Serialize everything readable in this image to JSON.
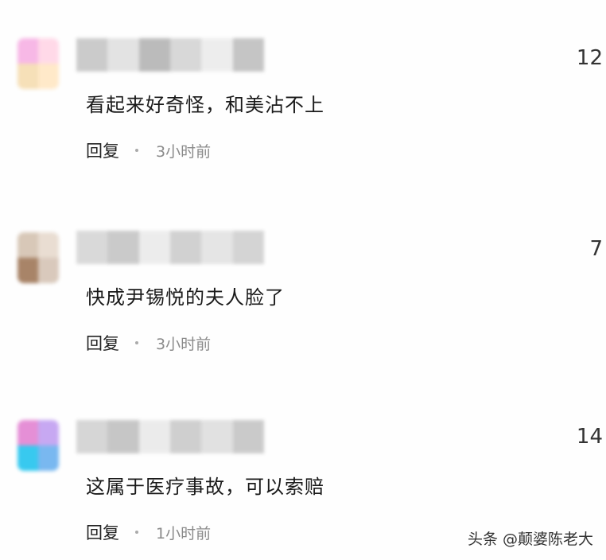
{
  "comments": [
    {
      "likes": "12",
      "text": "看起来好奇怪，和美沾不上",
      "reply_label": "回复",
      "time": "3小时前",
      "avatar_colors": [
        "#f7b8e6",
        "#ffd9e8",
        "#f6e0b8",
        "#ffe9c9"
      ],
      "username_colors": [
        "#c9c9c9",
        "#e2e2e2",
        "#b8b8b8",
        "#d6d6d6",
        "#ededed",
        "#c2c2c2"
      ]
    },
    {
      "likes": "7",
      "text": "快成尹锡悦的夫人脸了",
      "reply_label": "回复",
      "time": "3小时前",
      "avatar_colors": [
        "#d8c8b8",
        "#e9ddd2",
        "#a88468",
        "#d9c9bc"
      ],
      "username_colors": [
        "#d8d8d8",
        "#c8c8c8",
        "#ececec",
        "#cfcfcf",
        "#e4e4e4",
        "#d2d2d2"
      ]
    },
    {
      "likes": "14",
      "text": "这属于医疗事故，可以索赔",
      "reply_label": "回复",
      "time": "1小时前",
      "avatar_colors": [
        "#e58fd6",
        "#c7a8f2",
        "#38c9ef",
        "#79b8f0"
      ],
      "username_colors": [
        "#d4d4d4",
        "#c4c4c4",
        "#ebebeb",
        "#cdcdcd",
        "#e0e0e0",
        "#c8c8c8"
      ]
    }
  ],
  "watermark": "头条 @颠婆陈老大"
}
